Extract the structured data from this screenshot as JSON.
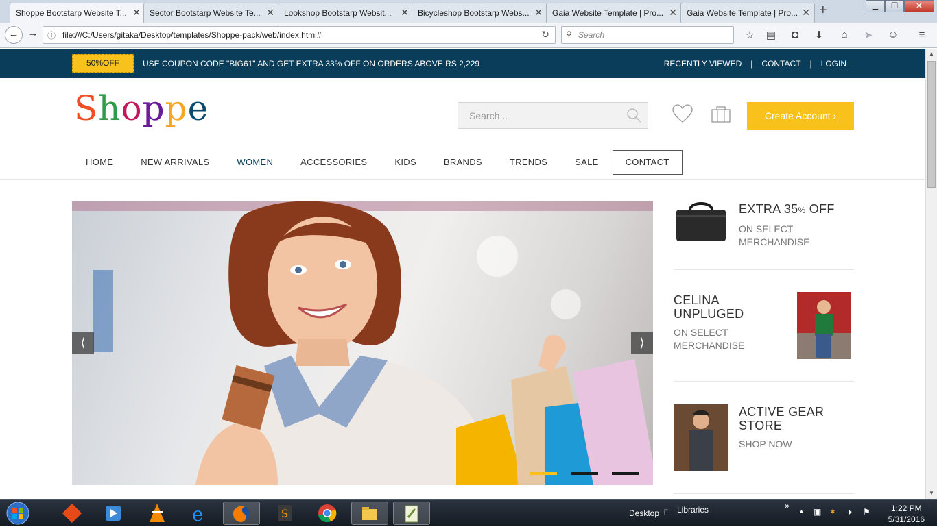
{
  "browser": {
    "tabs": [
      {
        "label": "Shoppe Bootstarp Website T...",
        "active": true
      },
      {
        "label": "Sector Bootstarp Website Te..."
      },
      {
        "label": "Lookshop Bootstarp Websit..."
      },
      {
        "label": "Bicycleshop Bootstarp Webs..."
      },
      {
        "label": "Gaia Website Template | Pro..."
      },
      {
        "label": "Gaia Website Template | Pro..."
      }
    ],
    "url": "file:///C:/Users/gitaka/Desktop/templates/Shoppe-pack/web/index.html#",
    "search_placeholder": "Search"
  },
  "topbar": {
    "badge": "50%OFF",
    "coupon_text": "USE COUPON CODE \"BIG61\" AND GET EXTRA 33% OFF ON ORDERS ABOVE RS 2,229",
    "links": [
      "RECENTLY VIEWED",
      "CONTACT",
      "LOGIN"
    ],
    "bg_color": "#0a3d5a",
    "accent_color": "#f8c11c"
  },
  "header": {
    "logo_text": [
      "S",
      "h",
      "o",
      "p",
      "p",
      "e"
    ],
    "search_placeholder": "Search...",
    "create_account": "Create Account"
  },
  "nav": {
    "items": [
      "HOME",
      "NEW ARRIVALS",
      "WOMEN",
      "ACCESSORIES",
      "KIDS",
      "BRANDS",
      "TRENDS",
      "SALE",
      "CONTACT"
    ],
    "active": "WOMEN",
    "boxed": "CONTACT"
  },
  "hero": {
    "prev": "⟨",
    "next": "⟩",
    "slides": 3,
    "active_slide": 1
  },
  "promos": [
    {
      "title": "EXTRA 35",
      "title_suffix": "%",
      "title_tail": " OFF",
      "sub": "ON SELECT MERCHANDISE"
    },
    {
      "title": "CELINA UNPLUGED",
      "sub": "ON SELECT MERCHANDISE"
    },
    {
      "title": "ACTIVE GEAR STORE",
      "sub": "SHOP NOW"
    }
  ],
  "taskbar": {
    "tray_desktop": "Desktop",
    "tray_libraries": "Libraries",
    "time": "1:22 PM",
    "date": "5/31/2016"
  }
}
